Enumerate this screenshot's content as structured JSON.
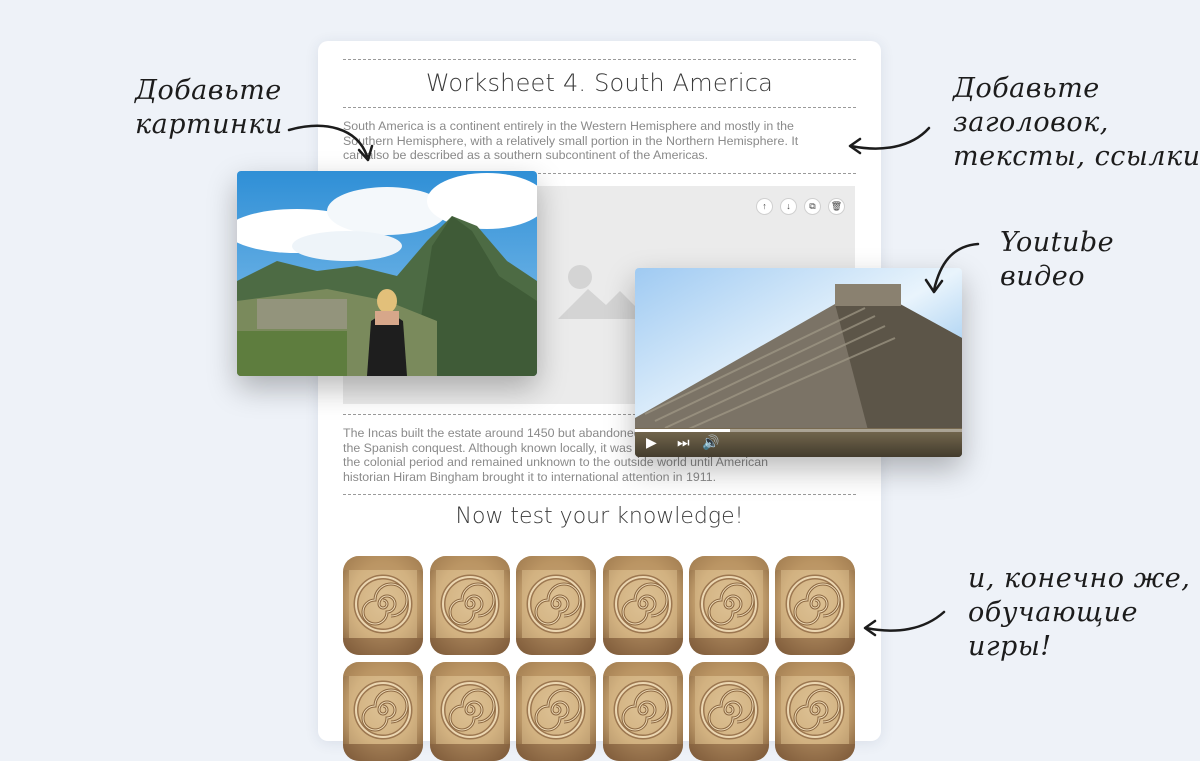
{
  "worksheet": {
    "title": "Worksheet 4. South America",
    "intro": "South America is a continent entirely in the Western Hemisphere and mostly in the Southern Hemisphere, with a relatively small portion in the Northern Hemisphere. It can also be described as a southern subcontinent of the Americas.",
    "history": "The Incas built the estate around 1450 but abandoned it a century later at the time of the Spanish conquest. Although known locally, it was not known to the Spanish during the colonial period and remained unknown to the outside world until American historian Hiram Bingham brought it to international attention in 1911.",
    "test_title": "Now test your knowledge!",
    "block_tools": [
      "move-up",
      "move-down",
      "duplicate",
      "delete"
    ],
    "tile_rows": 2,
    "tile_cols": 6
  },
  "video": {
    "progress": 0.29,
    "controls": [
      "play-icon",
      "next-icon",
      "volume-icon"
    ]
  },
  "annotations": {
    "images": [
      "Добавьте",
      "картинки"
    ],
    "texts": [
      "Добавьте",
      "заголовок,",
      "тексты, ссылки"
    ],
    "video": [
      "Youtube",
      "видео"
    ],
    "games": [
      "и, конечно же,",
      "обучающие",
      "игры!"
    ]
  },
  "colors": {
    "background": "#eef2f8",
    "sheet": "#ffffff",
    "text_muted": "#8a8a8a",
    "heading": "#3b3b3b",
    "placeholder": "#ebebeb"
  }
}
